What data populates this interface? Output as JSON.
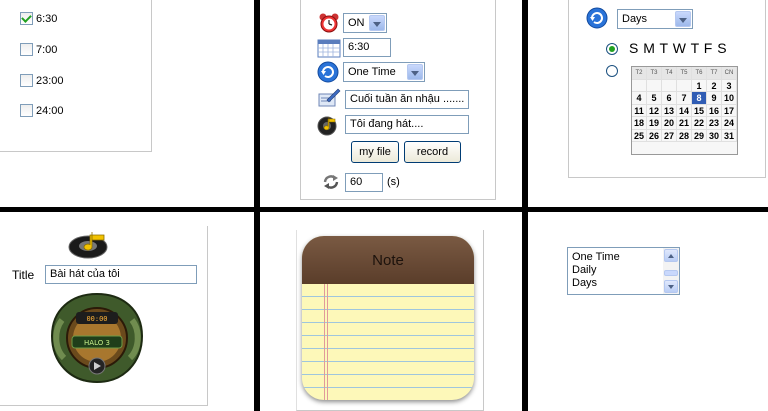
{
  "time_checklist": {
    "items": [
      {
        "label": "6:30",
        "checked": true
      },
      {
        "label": "7:00",
        "checked": false
      },
      {
        "label": "23:00",
        "checked": false
      },
      {
        "label": "24:00",
        "checked": false
      }
    ]
  },
  "alarm_form": {
    "alarm_state": "ON",
    "time": "6:30",
    "repeat": "One Time",
    "note": "Cuối tuần ăn nhậu .......",
    "song": "Tôi đang hát....",
    "my_file_label": "my file",
    "record_label": "record",
    "snooze_value": "60",
    "snooze_unit": "(s)"
  },
  "days_panel": {
    "mode": "Days",
    "weekdays_label": "S M T W T F S",
    "calendar": {
      "headers": [
        "T2",
        "T3",
        "T4",
        "T5",
        "T6",
        "T7",
        "CN"
      ],
      "rows": [
        [
          "",
          "",
          "",
          "",
          "1",
          "2",
          "3"
        ],
        [
          "4",
          "5",
          "6",
          "7",
          "8",
          "9",
          "10"
        ],
        [
          "11",
          "12",
          "13",
          "14",
          "15",
          "16",
          "17"
        ],
        [
          "18",
          "19",
          "20",
          "21",
          "22",
          "23",
          "24"
        ],
        [
          "25",
          "26",
          "27",
          "28",
          "29",
          "30",
          "31"
        ]
      ],
      "selected_day": "8"
    }
  },
  "song_panel": {
    "title_label": "Title",
    "title_value": "Bài hát của tôi",
    "player_display": "00:00",
    "player_brand": "HALO 3"
  },
  "notepad": {
    "title": "Note"
  },
  "repeat_listbox": {
    "options": [
      "One Time",
      "Daily",
      "Days"
    ]
  },
  "colors": {
    "accent_green": "#21a121",
    "xp_border": "#7f9db9",
    "note_header": "#6b4a35",
    "note_paper": "#fdf8b9",
    "calendar_selected": "#2f5cb4"
  },
  "icons": {
    "alarm": "alarm-clock-icon",
    "time": "calendar-time-icon",
    "repeat": "refresh-circle-icon",
    "note": "pen-note-icon",
    "song": "music-speaker-icon",
    "snooze": "recycle-arrows-icon"
  }
}
